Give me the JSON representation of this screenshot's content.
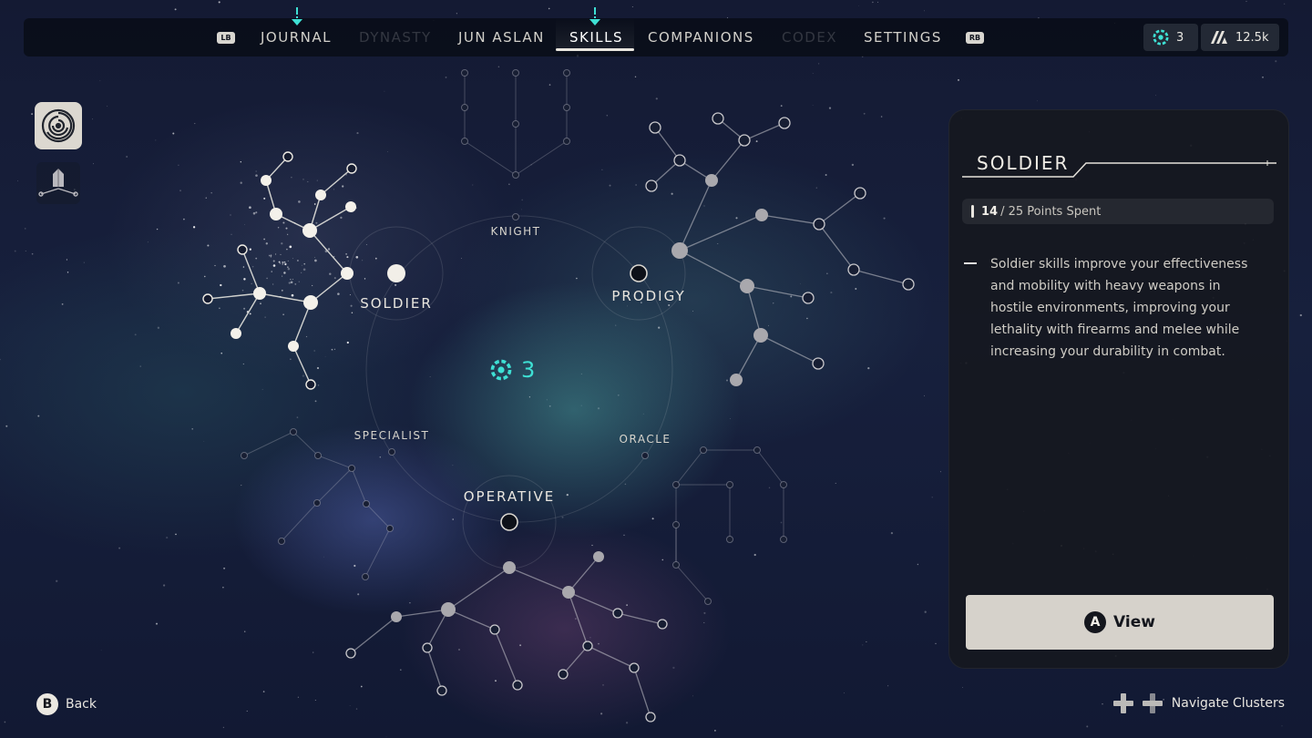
{
  "nav": {
    "left_bumper": "LB",
    "right_bumper": "RB",
    "tabs": [
      {
        "label": "JOURNAL",
        "state": "normal",
        "alert": true
      },
      {
        "label": "DYNASTY",
        "state": "disabled",
        "alert": false
      },
      {
        "label": "JUN ASLAN",
        "state": "normal",
        "alert": false
      },
      {
        "label": "SKILLS",
        "state": "active",
        "alert": true
      },
      {
        "label": "COMPANIONS",
        "state": "normal",
        "alert": false
      },
      {
        "label": "CODEX",
        "state": "disabled",
        "alert": false
      },
      {
        "label": "SETTINGS",
        "state": "normal",
        "alert": false
      }
    ],
    "skill_points": "3",
    "credits": "12.5k"
  },
  "colors": {
    "accent_teal": "#3ee0d4",
    "node_bright": "#f2efe8",
    "panel_bg": "#16181f"
  },
  "side_icons": [
    "labyrinth-icon",
    "crystal-cluster-icon"
  ],
  "map": {
    "clusters": {
      "soldier": "SOLDIER",
      "prodigy": "PRODIGY",
      "operative": "OPERATIVE",
      "knight": "KNIGHT",
      "specialist": "SPECIALIST",
      "oracle": "ORACLE"
    },
    "available_points": "3"
  },
  "panel": {
    "title": "SOLDIER",
    "points_spent": "14",
    "points_total_text": "/ 25 Points Spent",
    "description": "Soldier skills improve your effectiveness and mobility with heavy weapons in hostile environments, improving your lethality with firearms and melee while increasing your durability in combat.",
    "view_button_glyph": "A",
    "view_button_label": "View"
  },
  "footer": {
    "back_glyph": "B",
    "back_label": "Back",
    "navigate_label": "Navigate Clusters"
  }
}
